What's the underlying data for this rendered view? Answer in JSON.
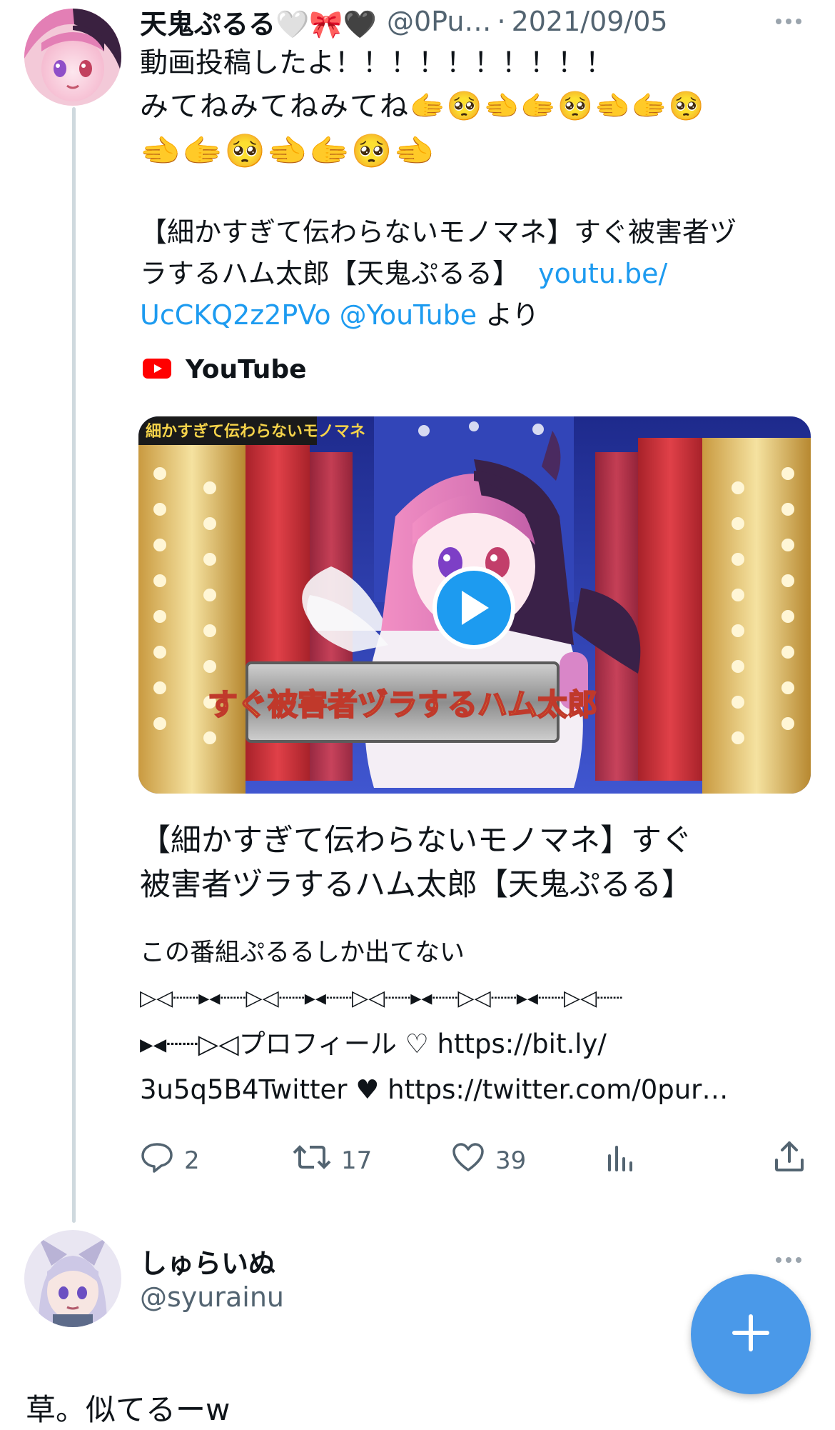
{
  "tweet": {
    "display_name": "天鬼ぷるる🤍🎀🖤",
    "handle": "@0Pu…",
    "separator": "·",
    "date": "2021/09/05",
    "line1": "動画投稿したよ！！！！！！！！！！",
    "line2": "みてねみてねみてね🫱🥺🫲🫱🥺🫲🫱🥺",
    "line3": "🫲🫱🥺🫲🫱🥺🫲",
    "share_text_a": "【細かすぎて伝わらないモノマネ】すぐ被害者ヅ",
    "share_text_b": "ラするハム太郎【天鬼ぷるる】",
    "link_part1": "youtu.be/",
    "link_part2": "UcCKQ2z2PVo @YouTube",
    "link_suffix": "より",
    "source_label": "YouTube",
    "video_overlay_banner": "細かすぎて伝わらないモノマネ",
    "video_overlay_caption": "すぐ被害者ヅラするハム太郎",
    "card_title_line1": "【細かすぎて伝わらないモノマネ】すぐ",
    "card_title_line2": "被害者ヅラするハム太郎【天鬼ぷるる】",
    "card_desc_line1": "この番組ぷるるしか出てない",
    "card_desc_line2": "▷◁┈┈▸◂┈┈▷◁┈┈▸◂┈┈▷◁┈┈▸◂┈┈▷◁┈┈▸◂┈┈▷◁┈┈",
    "card_desc_line3": "▸◂┈┈▷◁プロフィール ♡ https://bit.ly/",
    "card_desc_line4": "3u5q5B4Twitter ♥ https://twitter.com/0pur…",
    "replies": "2",
    "retweets": "17",
    "likes": "39"
  },
  "reply": {
    "display_name": "しゅらいぬ",
    "handle": "@syurainu",
    "text": "草。似てるーw"
  },
  "colors": {
    "accent": "#1d9bf0",
    "fab": "#4a99e9",
    "youtube_red": "#ff0000",
    "muted": "#536471"
  },
  "icons": [
    "more-icon",
    "youtube-logo-icon",
    "play-icon",
    "reply-icon",
    "retweet-icon",
    "like-icon",
    "views-icon",
    "share-icon",
    "compose-plus-icon"
  ]
}
